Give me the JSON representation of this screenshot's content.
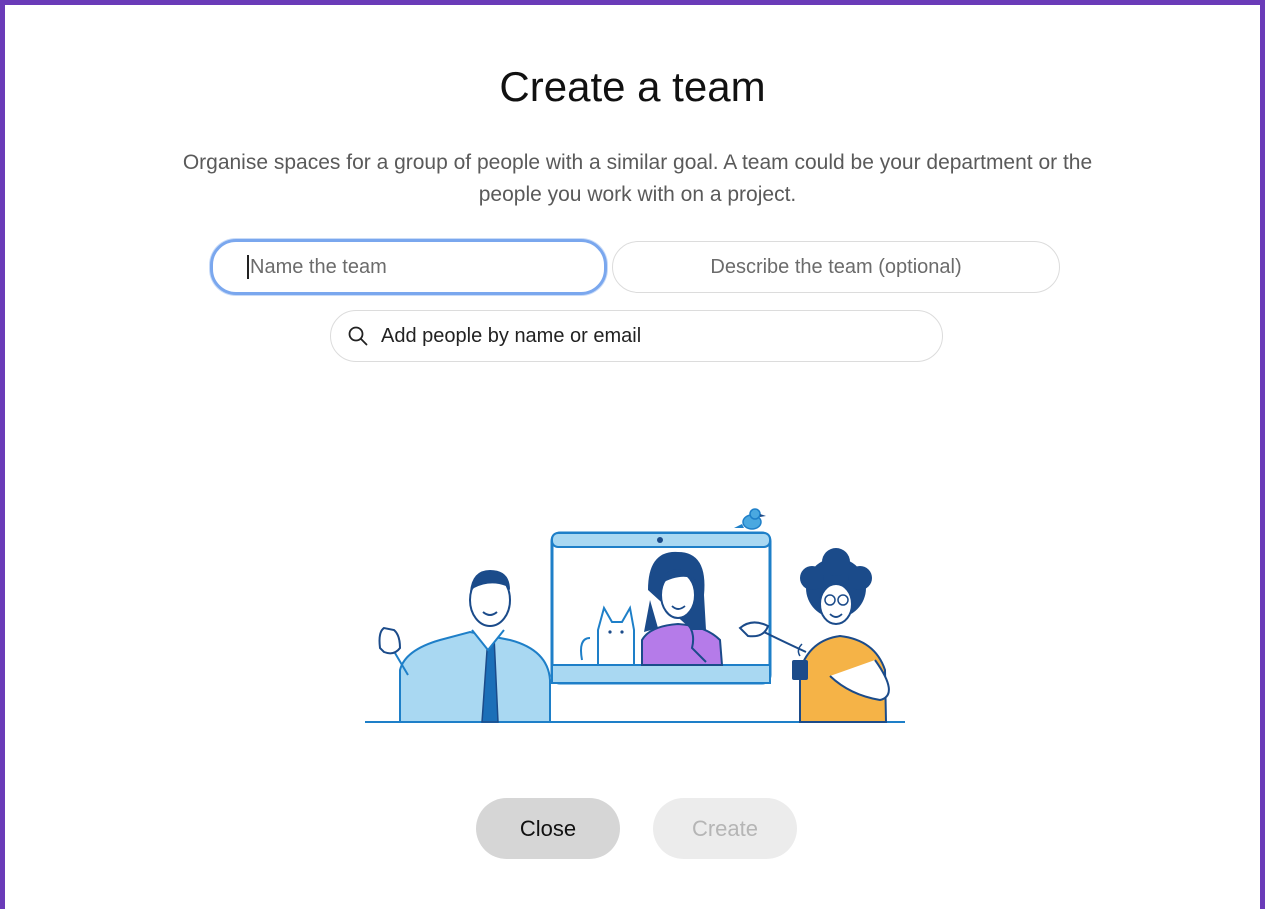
{
  "dialog": {
    "title": "Create a team",
    "subtitle": "Organise spaces for a group of people with a similar goal. A team could be your department or the people you work with on a project."
  },
  "form": {
    "team_name": {
      "value": "",
      "placeholder": "Name the team"
    },
    "team_description": {
      "value": "",
      "placeholder": "Describe the team (optional)"
    },
    "add_people": {
      "value": "",
      "placeholder": "Add people by name or email",
      "icon": "search-icon"
    }
  },
  "illustration": {
    "icon": "team-video-call-illustration",
    "colors": {
      "line": "#1e7fc8",
      "light_blue": "#a9d8f2",
      "purple": "#b57be9",
      "orange": "#f5b347",
      "navy": "#1b4b8a"
    }
  },
  "buttons": {
    "close_label": "Close",
    "create_label": "Create",
    "create_enabled": false
  },
  "colors": {
    "frame_border": "#6a3bb8",
    "focus_ring": "#7aa7ee",
    "close_bg": "#d6d6d6",
    "create_bg": "#ececec"
  }
}
